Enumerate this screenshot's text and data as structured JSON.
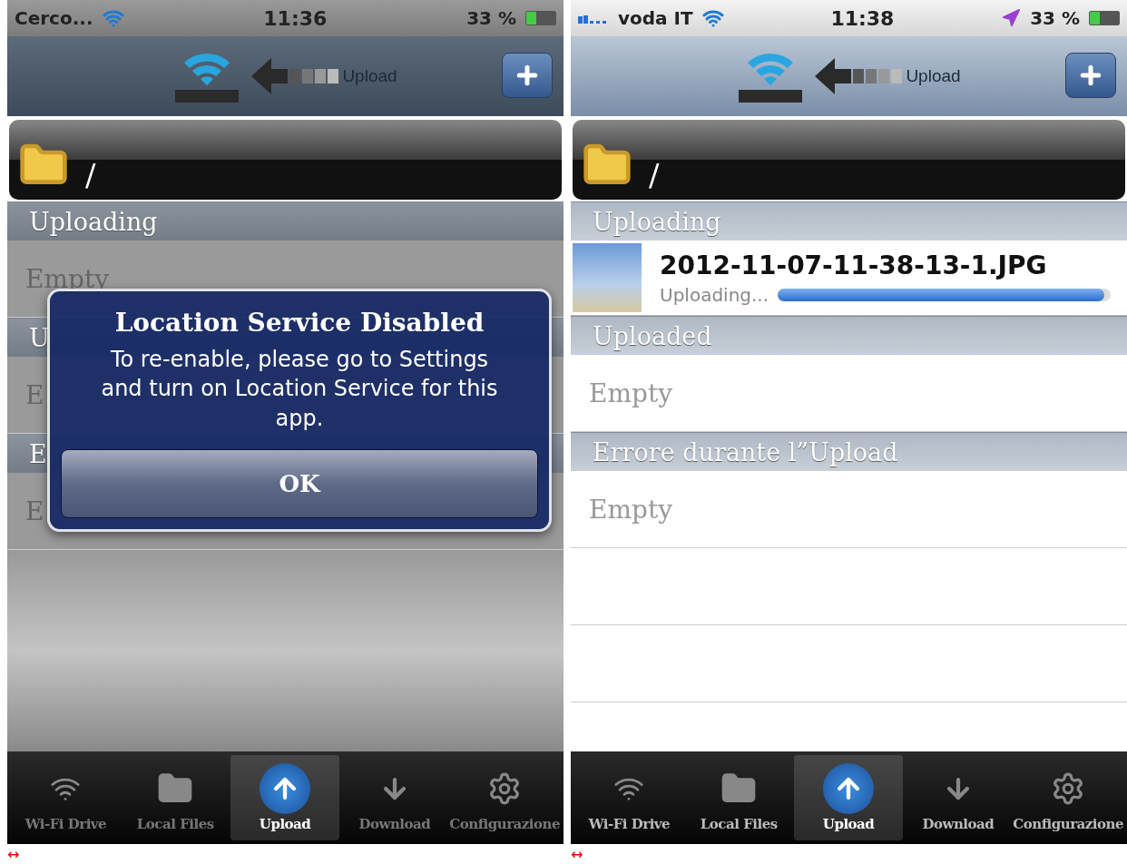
{
  "screens": [
    {
      "status_bar": {
        "carrier": "Cerco...",
        "signal": false,
        "location": false,
        "time": "11:36",
        "battery": "33 %"
      },
      "nav_bar": {
        "title": "Upload"
      },
      "path": "/",
      "sections": [
        {
          "header": "Uploading",
          "rows": [
            {
              "kind": "empty",
              "text": "Empty"
            }
          ]
        },
        {
          "header": "U",
          "rows": [
            {
              "kind": "empty",
              "text": "E"
            }
          ]
        },
        {
          "header": "E",
          "rows": [
            {
              "kind": "empty",
              "text": "E"
            }
          ]
        }
      ],
      "alert": {
        "title": "Location Service Disabled",
        "message": "To re-enable, please go to Settings and turn on Location Service for this app.",
        "button": "OK"
      },
      "tabs": [
        {
          "label": "Wi-Fi Drive",
          "selected": false
        },
        {
          "label": "Local Files",
          "selected": false
        },
        {
          "label": "Upload",
          "selected": true
        },
        {
          "label": "Download",
          "selected": false
        },
        {
          "label": "Configurazione",
          "selected": false
        }
      ],
      "caption": "↔"
    },
    {
      "status_bar": {
        "carrier": "voda IT",
        "signal": true,
        "location": true,
        "time": "11:38",
        "battery": "33 %"
      },
      "nav_bar": {
        "title": "Upload"
      },
      "path": "/",
      "sections": [
        {
          "header": "Uploading",
          "rows": [
            {
              "kind": "file",
              "name": "2012-11-07-11-38-13-1.JPG",
              "status": "Uploading...",
              "level": 0.98
            }
          ]
        },
        {
          "header": "Uploaded",
          "rows": [
            {
              "kind": "empty",
              "text": "Empty"
            }
          ]
        },
        {
          "header": "Errore durante l”Upload",
          "rows": [
            {
              "kind": "empty",
              "text": "Empty"
            }
          ]
        }
      ],
      "tabs": [
        {
          "label": "Wi-Fi Drive",
          "selected": false
        },
        {
          "label": "Local Files",
          "selected": false
        },
        {
          "label": "Upload",
          "selected": true
        },
        {
          "label": "Download",
          "selected": false
        },
        {
          "label": "Configurazione",
          "selected": false
        }
      ],
      "caption": "↔"
    }
  ]
}
